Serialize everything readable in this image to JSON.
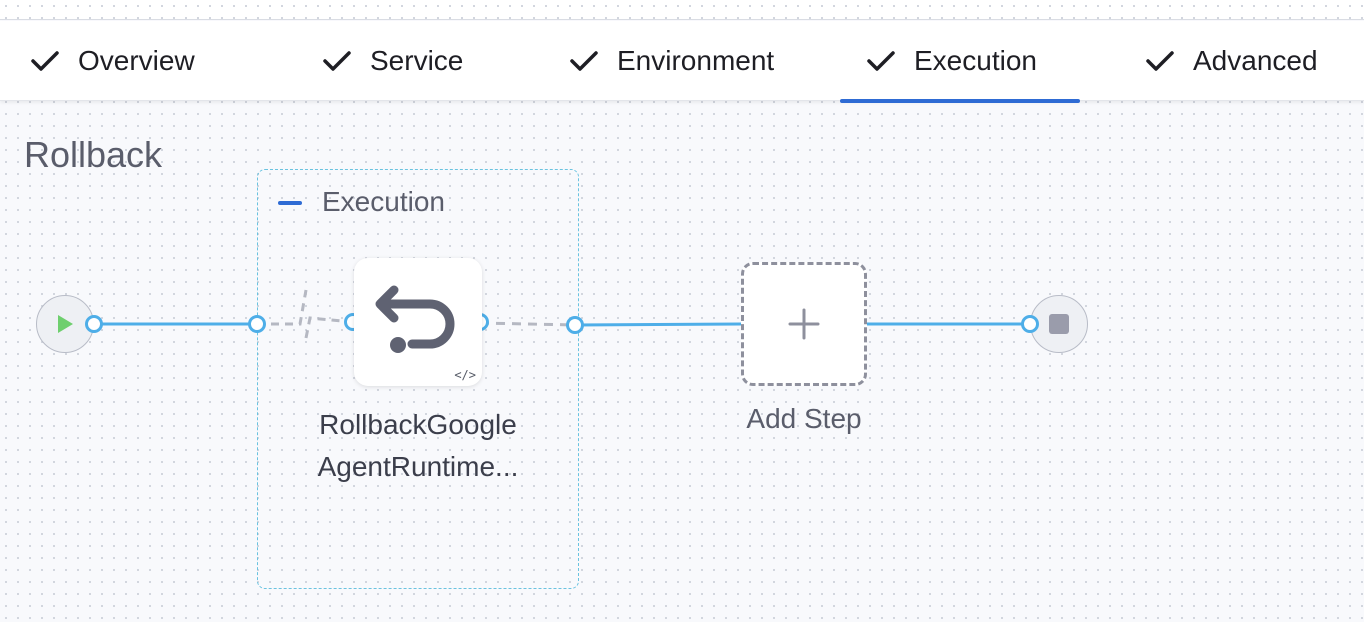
{
  "tabs": [
    {
      "label": "Overview",
      "completed": true
    },
    {
      "label": "Service",
      "completed": true
    },
    {
      "label": "Environment",
      "completed": true
    },
    {
      "label": "Execution",
      "completed": true,
      "active": true
    },
    {
      "label": "Advanced",
      "completed": true
    }
  ],
  "section": {
    "title": "Rollback"
  },
  "group": {
    "label": "Execution"
  },
  "step": {
    "name_line1": "RollbackGoogle",
    "name_line2": "AgentRuntime...",
    "code_badge": "</>"
  },
  "add_step": {
    "label": "Add Step"
  },
  "colors": {
    "accent": "#2e6bd4",
    "wire": "#4eaee8",
    "group_border": "#6ac3e0",
    "start_play": "#6ecf6e"
  },
  "icons": [
    "check-icon",
    "play-icon",
    "stop-icon",
    "rollback-icon",
    "plus-icon",
    "code-icon",
    "collapse-icon"
  ]
}
